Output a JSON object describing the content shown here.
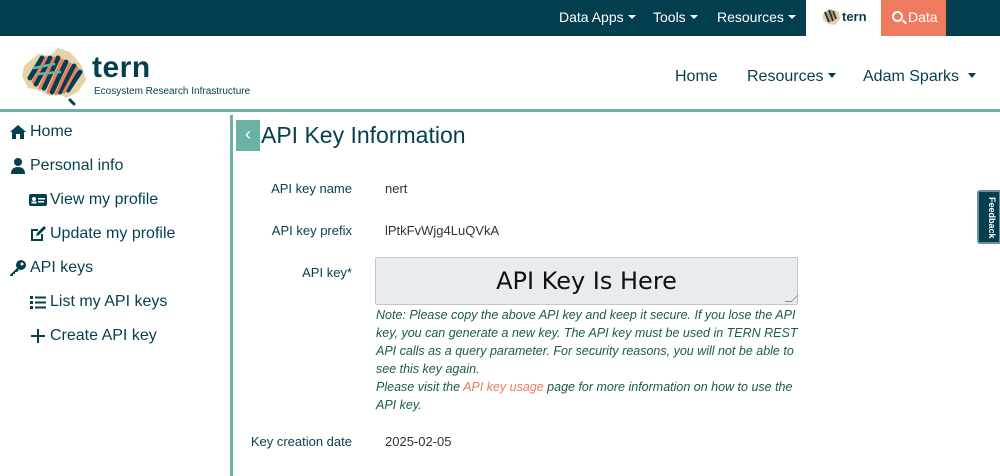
{
  "topbar": {
    "data_apps": "Data Apps",
    "tools": "Tools",
    "resources": "Resources",
    "tern_mini": "tern",
    "data_button": "Data"
  },
  "header": {
    "logo_name": "tern",
    "logo_subtitle": "Ecosystem Research Infrastructure",
    "nav": {
      "home": "Home",
      "resources": "Resources",
      "user": "Adam Sparks"
    }
  },
  "sidebar": {
    "items": [
      {
        "label": "Home",
        "icon": "home-icon"
      },
      {
        "label": "Personal info",
        "icon": "user-icon"
      },
      {
        "label": "View my profile",
        "icon": "id-card-icon"
      },
      {
        "label": "Update my profile",
        "icon": "edit-icon"
      },
      {
        "label": "API keys",
        "icon": "key-icon"
      },
      {
        "label": "List my API keys",
        "icon": "list-icon"
      },
      {
        "label": "Create API key",
        "icon": "plus-icon"
      }
    ]
  },
  "main": {
    "collapse_glyph": "‹",
    "title": "API Key Information",
    "fields": {
      "name_label": "API key name",
      "name_value": "nert",
      "prefix_label": "API key prefix",
      "prefix_value": "lPtkFvWjg4LuQVkA",
      "key_label": "API key*",
      "key_value": "API Key Is Here",
      "date_label": "Key creation date",
      "date_value": "2025-02-05"
    },
    "note": {
      "line1": "Note: Please copy the above API key and keep it secure. If you lose the API key, you can generate a new key. The API key must be used in TERN REST API calls as a query parameter. For security reasons, you will not be able to see this key again.",
      "visit_prefix": "Please visit the ",
      "link_text": "API key usage",
      "visit_suffix": " page for more information on how to use the API key."
    }
  },
  "feedback": {
    "label": "Feedback"
  },
  "colors": {
    "navy": "#043f50",
    "teal": "#6ab1a6",
    "coral": "#ee7b5e",
    "note_green": "#1b5e3e"
  }
}
